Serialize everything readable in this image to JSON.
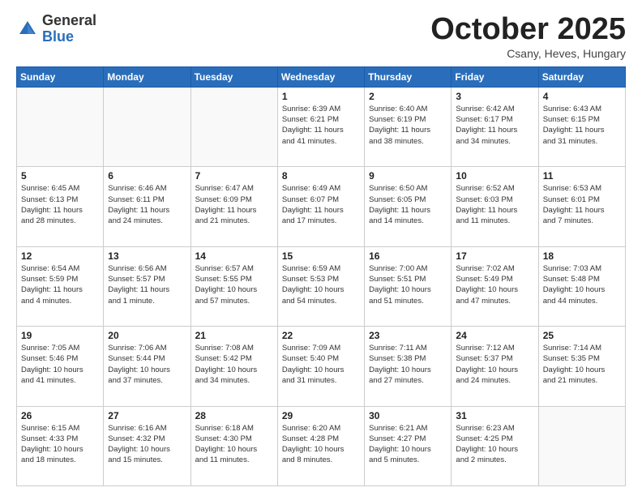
{
  "logo": {
    "general": "General",
    "blue": "Blue"
  },
  "header": {
    "month": "October 2025",
    "location": "Csany, Heves, Hungary"
  },
  "days_of_week": [
    "Sunday",
    "Monday",
    "Tuesday",
    "Wednesday",
    "Thursday",
    "Friday",
    "Saturday"
  ],
  "weeks": [
    [
      {
        "day": "",
        "info": ""
      },
      {
        "day": "",
        "info": ""
      },
      {
        "day": "",
        "info": ""
      },
      {
        "day": "1",
        "info": "Sunrise: 6:39 AM\nSunset: 6:21 PM\nDaylight: 11 hours\nand 41 minutes."
      },
      {
        "day": "2",
        "info": "Sunrise: 6:40 AM\nSunset: 6:19 PM\nDaylight: 11 hours\nand 38 minutes."
      },
      {
        "day": "3",
        "info": "Sunrise: 6:42 AM\nSunset: 6:17 PM\nDaylight: 11 hours\nand 34 minutes."
      },
      {
        "day": "4",
        "info": "Sunrise: 6:43 AM\nSunset: 6:15 PM\nDaylight: 11 hours\nand 31 minutes."
      }
    ],
    [
      {
        "day": "5",
        "info": "Sunrise: 6:45 AM\nSunset: 6:13 PM\nDaylight: 11 hours\nand 28 minutes."
      },
      {
        "day": "6",
        "info": "Sunrise: 6:46 AM\nSunset: 6:11 PM\nDaylight: 11 hours\nand 24 minutes."
      },
      {
        "day": "7",
        "info": "Sunrise: 6:47 AM\nSunset: 6:09 PM\nDaylight: 11 hours\nand 21 minutes."
      },
      {
        "day": "8",
        "info": "Sunrise: 6:49 AM\nSunset: 6:07 PM\nDaylight: 11 hours\nand 17 minutes."
      },
      {
        "day": "9",
        "info": "Sunrise: 6:50 AM\nSunset: 6:05 PM\nDaylight: 11 hours\nand 14 minutes."
      },
      {
        "day": "10",
        "info": "Sunrise: 6:52 AM\nSunset: 6:03 PM\nDaylight: 11 hours\nand 11 minutes."
      },
      {
        "day": "11",
        "info": "Sunrise: 6:53 AM\nSunset: 6:01 PM\nDaylight: 11 hours\nand 7 minutes."
      }
    ],
    [
      {
        "day": "12",
        "info": "Sunrise: 6:54 AM\nSunset: 5:59 PM\nDaylight: 11 hours\nand 4 minutes."
      },
      {
        "day": "13",
        "info": "Sunrise: 6:56 AM\nSunset: 5:57 PM\nDaylight: 11 hours\nand 1 minute."
      },
      {
        "day": "14",
        "info": "Sunrise: 6:57 AM\nSunset: 5:55 PM\nDaylight: 10 hours\nand 57 minutes."
      },
      {
        "day": "15",
        "info": "Sunrise: 6:59 AM\nSunset: 5:53 PM\nDaylight: 10 hours\nand 54 minutes."
      },
      {
        "day": "16",
        "info": "Sunrise: 7:00 AM\nSunset: 5:51 PM\nDaylight: 10 hours\nand 51 minutes."
      },
      {
        "day": "17",
        "info": "Sunrise: 7:02 AM\nSunset: 5:49 PM\nDaylight: 10 hours\nand 47 minutes."
      },
      {
        "day": "18",
        "info": "Sunrise: 7:03 AM\nSunset: 5:48 PM\nDaylight: 10 hours\nand 44 minutes."
      }
    ],
    [
      {
        "day": "19",
        "info": "Sunrise: 7:05 AM\nSunset: 5:46 PM\nDaylight: 10 hours\nand 41 minutes."
      },
      {
        "day": "20",
        "info": "Sunrise: 7:06 AM\nSunset: 5:44 PM\nDaylight: 10 hours\nand 37 minutes."
      },
      {
        "day": "21",
        "info": "Sunrise: 7:08 AM\nSunset: 5:42 PM\nDaylight: 10 hours\nand 34 minutes."
      },
      {
        "day": "22",
        "info": "Sunrise: 7:09 AM\nSunset: 5:40 PM\nDaylight: 10 hours\nand 31 minutes."
      },
      {
        "day": "23",
        "info": "Sunrise: 7:11 AM\nSunset: 5:38 PM\nDaylight: 10 hours\nand 27 minutes."
      },
      {
        "day": "24",
        "info": "Sunrise: 7:12 AM\nSunset: 5:37 PM\nDaylight: 10 hours\nand 24 minutes."
      },
      {
        "day": "25",
        "info": "Sunrise: 7:14 AM\nSunset: 5:35 PM\nDaylight: 10 hours\nand 21 minutes."
      }
    ],
    [
      {
        "day": "26",
        "info": "Sunrise: 6:15 AM\nSunset: 4:33 PM\nDaylight: 10 hours\nand 18 minutes."
      },
      {
        "day": "27",
        "info": "Sunrise: 6:16 AM\nSunset: 4:32 PM\nDaylight: 10 hours\nand 15 minutes."
      },
      {
        "day": "28",
        "info": "Sunrise: 6:18 AM\nSunset: 4:30 PM\nDaylight: 10 hours\nand 11 minutes."
      },
      {
        "day": "29",
        "info": "Sunrise: 6:20 AM\nSunset: 4:28 PM\nDaylight: 10 hours\nand 8 minutes."
      },
      {
        "day": "30",
        "info": "Sunrise: 6:21 AM\nSunset: 4:27 PM\nDaylight: 10 hours\nand 5 minutes."
      },
      {
        "day": "31",
        "info": "Sunrise: 6:23 AM\nSunset: 4:25 PM\nDaylight: 10 hours\nand 2 minutes."
      },
      {
        "day": "",
        "info": ""
      }
    ]
  ]
}
